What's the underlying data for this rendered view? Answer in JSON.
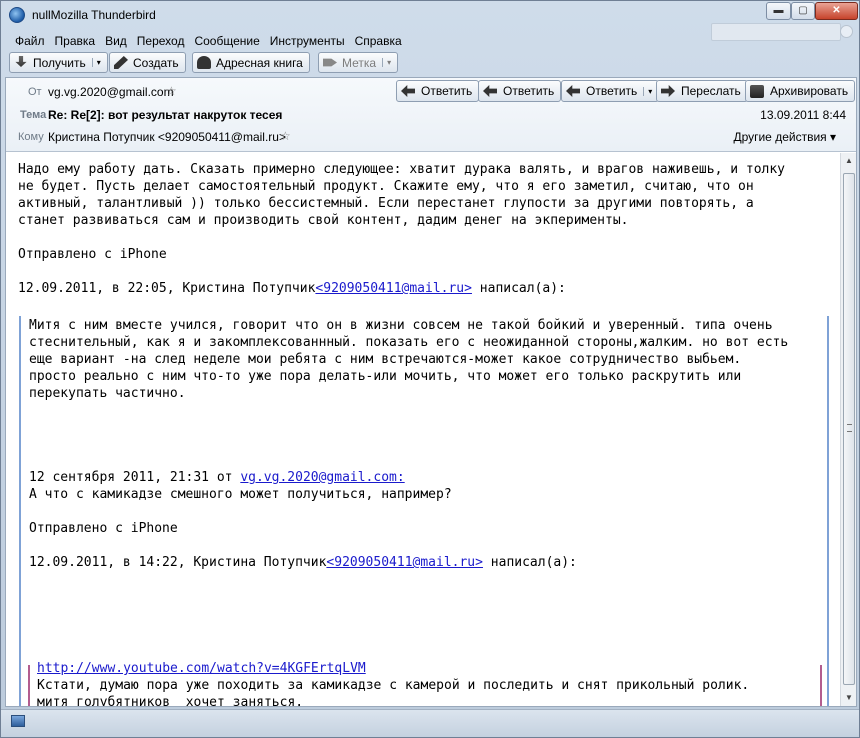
{
  "window": {
    "title": "nullMozilla Thunderbird",
    "minimize_label": "▬",
    "maximize_label": "▢",
    "close_label": "✕"
  },
  "menubar": {
    "items": [
      "Файл",
      "Правка",
      "Вид",
      "Переход",
      "Сообщение",
      "Инструменты",
      "Справка"
    ]
  },
  "toolbar": {
    "get_label": "Получить",
    "create_label": "Создать",
    "addressbook_label": "Адресная книга",
    "tag_label": "Метка",
    "dropdown_glyph": "▾"
  },
  "header": {
    "from_label": "От",
    "from_value": "vg.vg.2020@gmail.com",
    "subject_label": "Тема",
    "subject_value": "Re: Re[2]: вот результат накруток тесея",
    "to_label": "Кому",
    "to_value": "Кристина Потупчик <9209050411@mail.ru>",
    "date": "13.09.2011 8:44",
    "other_actions": "Другие действия ▾",
    "star_glyph": "☆",
    "buttons": {
      "reply": "Ответить",
      "reply_all": "Ответить",
      "reply_list": "Ответить",
      "forward": "Переслать",
      "archive": "Архивировать"
    }
  },
  "body": {
    "para1": [
      "Надо ему работу дать. Сказать примерно следующее: хватит дурака валять, и врагов наживешь, и толку",
      "не будет. Пусть делает самостоятельный продукт. Скажите ему, что я его заметил, считаю, что он",
      "активный, талантливый )) только бессистемный. Если перестанет глупости за другими повторять, а",
      "станет развиваться сам и производить свой контент, дадим денег на экперименты."
    ],
    "sent_from1": "Отправлено с iPhone",
    "attrib1_prefix": "12.09.2011, в 22:05, Кристина Потупчик",
    "attrib1_link": "<9209050411@mail.ru>",
    "attrib1_suffix": " написал(а):",
    "quote1": [
      "Митя с ним вместе учился, говорит что он в жизни совсем не такой бойкий и уверенный. типа очень",
      "стеснительный, как я и закомплексованнный. показать его с неожиданной стороны,жалким. но вот есть",
      "еще вариант -на след неделе мои ребята с ним встречаются-может какое сотрудничество выбьем.",
      "просто реально с ним что-то уже пора делать-или мочить, что может его только раскрутить или",
      "перекупать частично."
    ],
    "attrib2_prefix": "12 сентября 2011, 21:31 от ",
    "attrib2_link": "vg.vg.2020@gmail.com:",
    "line_question": "А что с камикадзе смешного может получиться, например?",
    "sent_from2": "Отправлено с iPhone",
    "attrib3_prefix": "12.09.2011, в 14:22, Кристина Потупчик",
    "attrib3_link": "<9209050411@mail.ru>",
    "attrib3_suffix": " написал(а):",
    "youtube_link": "http://www.youtube.com/watch?v=4KGFErtqLVM",
    "quote2": [
      "Кстати, думаю пора уже походить за камикадзе с камерой и последить и снят прикольный ролик.",
      "митя голубятников  хочет заняться."
    ]
  },
  "scrollbar": {
    "up_glyph": "▲",
    "down_glyph": "▼"
  }
}
